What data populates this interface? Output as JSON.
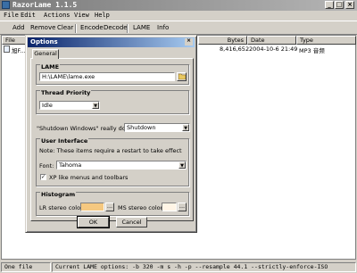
{
  "window": {
    "title": "RazorLame 1.1.5"
  },
  "menu": [
    "File",
    "Edit",
    "Actions",
    "View",
    "Help"
  ],
  "toolbar": [
    "Add",
    "Remove",
    "Clear",
    "Encode",
    "Decode",
    "LAME",
    "Info"
  ],
  "list": {
    "columns": [
      "File",
      "Bytes",
      "Date",
      "Type"
    ],
    "row": {
      "file": "旭F...",
      "bytes": "8,416,652",
      "date": "2004-10-6 21:49",
      "type": "MP3 音频"
    }
  },
  "status": {
    "files": "One file",
    "options": "Current LAME options:  -b 320 -m s -h -p --resample 44.1 --strictly-enforce-ISO"
  },
  "dialog": {
    "title": "Options",
    "tab": "General",
    "lame": {
      "title": "LAME",
      "path": "H:\\LAME\\lame.exe"
    },
    "priority": {
      "title": "Thread Priority",
      "value": "Idle"
    },
    "shutdown": {
      "label": "\"Shutdown Windows\" really does:",
      "value": "Shutdown"
    },
    "ui": {
      "title": "User Interface",
      "note": "Note: These items require a restart to take effect",
      "font_label": "Font:",
      "font_value": "Tahoma",
      "xp_label": "XP like menus and toolbars",
      "xp_checked": true
    },
    "histogram": {
      "title": "Histogram",
      "lr_label": "LR stereo color:",
      "ms_label": "MS stereo color:",
      "lr_color": "#f5c880",
      "ms_color": "#fff5e6",
      "browse": "..."
    },
    "ok": "OK",
    "cancel": "Cancel"
  }
}
